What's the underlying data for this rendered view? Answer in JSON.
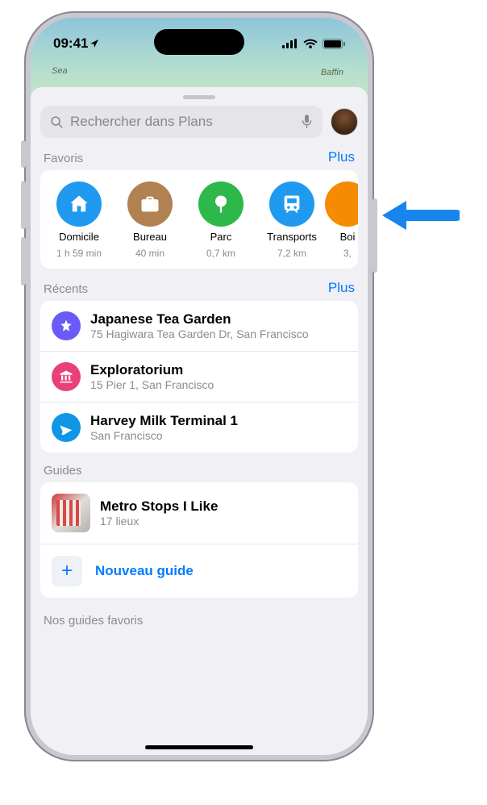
{
  "status": {
    "time": "09:41"
  },
  "search": {
    "placeholder": "Rechercher dans Plans"
  },
  "colors": {
    "accent": "#007aff",
    "fav_home": "#1f9af0",
    "fav_work": "#b08252",
    "fav_park": "#2fb84a",
    "fav_transit": "#1f9af0",
    "fav_extra": "#f58b00",
    "recent_star": "#6a5af9",
    "recent_museum": "#e8417a",
    "recent_plane": "#1195e6"
  },
  "favorites": {
    "header": "Favoris",
    "more": "Plus",
    "items": [
      {
        "label": "Domicile",
        "sub": "1 h 59 min",
        "icon": "home",
        "color_key": "fav_home"
      },
      {
        "label": "Bureau",
        "sub": "40 min",
        "icon": "briefcase",
        "color_key": "fav_work"
      },
      {
        "label": "Parc",
        "sub": "0,7 km",
        "icon": "tree",
        "color_key": "fav_park"
      },
      {
        "label": "Transports",
        "sub": "7,2 km",
        "icon": "train",
        "color_key": "fav_transit"
      },
      {
        "label": "Boi",
        "sub": "3,",
        "icon": "dot",
        "color_key": "fav_extra"
      }
    ]
  },
  "recents": {
    "header": "Récents",
    "more": "Plus",
    "items": [
      {
        "title": "Japanese Tea Garden",
        "sub": "75 Hagiwara Tea Garden Dr, San Francisco",
        "icon": "star",
        "color_key": "recent_star"
      },
      {
        "title": "Exploratorium",
        "sub": "15 Pier 1, San Francisco",
        "icon": "museum",
        "color_key": "recent_museum"
      },
      {
        "title": "Harvey Milk Terminal 1",
        "sub": "San Francisco",
        "icon": "plane",
        "color_key": "recent_plane"
      }
    ]
  },
  "guides": {
    "header": "Guides",
    "items": [
      {
        "title": "Metro Stops I Like",
        "sub": "17 lieux"
      }
    ],
    "new_label": "Nouveau guide"
  },
  "footer": {
    "label": "Nos guides favoris"
  },
  "map_labels": {
    "sea": "Sea",
    "baffin": "Baffin"
  }
}
